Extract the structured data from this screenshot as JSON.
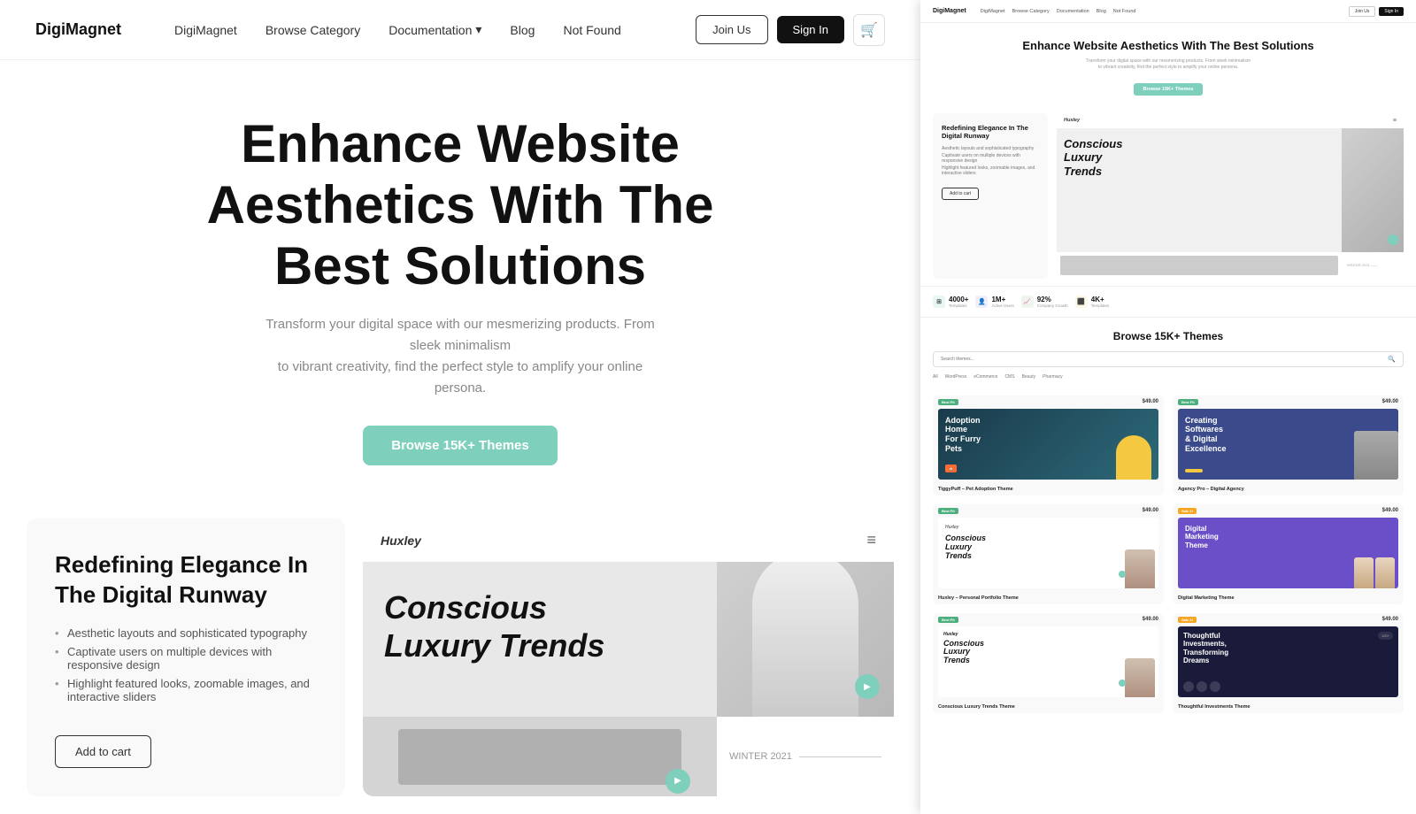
{
  "leftPanel": {
    "nav": {
      "logo": "DigiMagnet",
      "links": [
        {
          "label": "DigiMagnet"
        },
        {
          "label": "Browse Category"
        },
        {
          "label": "Documentation",
          "hasChevron": true
        },
        {
          "label": "Blog"
        },
        {
          "label": "Not Found"
        }
      ],
      "joinUs": "Join Us",
      "signIn": "Sign In",
      "cartIcon": "🛒"
    },
    "hero": {
      "title": "Enhance Website Aesthetics With The Best Solutions",
      "subtitle": "Transform your digital space with our mesmerizing products. From sleek minimalism\nto vibrant creativity, find the perfect style to amplify your online persona.",
      "ctaButton": "Browse 15K+ Themes"
    },
    "productCard": {
      "title": "Redefining Elegance In The Digital Runway",
      "feature1": "Aesthetic layouts and sophisticated typography",
      "feature2": "Captivate users on multiple devices with responsive design",
      "feature3": "Highlight featured looks, zoomable images, and interactive sliders",
      "addToCart": "Add to cart"
    },
    "previewCard": {
      "brand": "Huxley",
      "bigText": "Conscious\nLuxury Trends",
      "season": "WINTER 2021",
      "playLabel": "PLAY VIDEO"
    }
  },
  "rightPanel": {
    "nav": {
      "logo": "DigiMagnet",
      "links": [
        "DigiMagnet",
        "Browse Category",
        "Documentation",
        "Blog",
        "Not Found"
      ],
      "joinUs": "Join Us",
      "signIn": "Sign In"
    },
    "hero": {
      "title": "Enhance Website Aesthetics With The Best Solutions",
      "subtitle": "Transform your digital space with our mesmerizing products. From sleek minimalism to vibrant creativity, find the perfect style to amplify your online persona.",
      "ctaButton": "Browse 15K+ Themes"
    },
    "stats": [
      {
        "icon": "⊞",
        "iconClass": "teal",
        "number": "4000+",
        "label": "Templates"
      },
      {
        "icon": "👤",
        "iconClass": "lavender",
        "number": "1M+",
        "label": "Active Users"
      },
      {
        "icon": "📈",
        "iconClass": "green",
        "number": "92%",
        "label": "Company Growth"
      },
      {
        "icon": "⬛",
        "iconClass": "yellow",
        "number": "4K+",
        "label": "Templates"
      }
    ],
    "browseSection": {
      "title": "Browse 15K+ Themes",
      "searchPlaceholder": "Search themes...",
      "filters": [
        "All",
        "WordPress",
        "eCommerce",
        "CMS",
        "Beauty",
        "Pharmacy"
      ]
    },
    "themes": [
      {
        "badge": "Best Fit",
        "badgeClass": "badge-green",
        "price": "$49.00",
        "name": "TiggyPuff – Pet Adoption Theme",
        "previewClass": "theme-preview-1"
      },
      {
        "badge": "Best Fit",
        "badgeClass": "badge-green",
        "price": "$49.00",
        "name": "Agency Pro – Digital Agency",
        "previewClass": "theme-preview-2"
      },
      {
        "badge": "Best Fit",
        "badgeClass": "badge-green",
        "price": "$49.00",
        "name": "Huxley – Personal Portfolio Theme",
        "previewClass": "theme-preview-3"
      },
      {
        "badge": "Sale 2!",
        "badgeClass": "badge-orange",
        "price": "$49.00",
        "name": "Digital Marketing Theme",
        "previewClass": "theme-preview-4"
      }
    ],
    "themesRow2": [
      {
        "badge": "Best Fit",
        "badgeClass": "badge-green",
        "price": "$49.00",
        "name": "Conscious Luxury Trends Theme",
        "previewClass": "theme-preview-5"
      },
      {
        "badge": "Sale 2!",
        "badgeClass": "badge-orange",
        "price": "$49.00",
        "name": "Thoughtful Investments Theme",
        "previewClass": "theme-preview-6"
      }
    ]
  }
}
